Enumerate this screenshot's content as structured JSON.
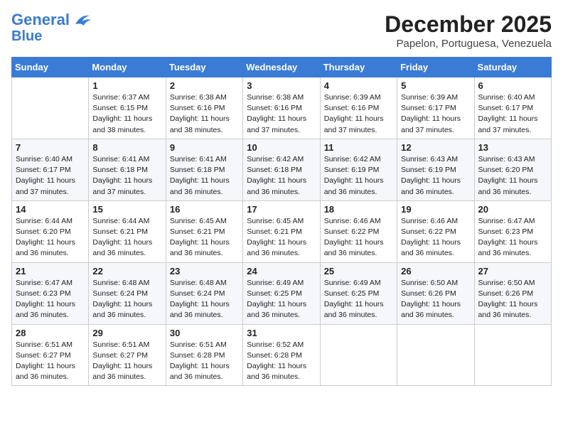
{
  "header": {
    "logo_line1": "General",
    "logo_line2": "Blue",
    "month": "December 2025",
    "location": "Papelon, Portuguesa, Venezuela"
  },
  "days_of_week": [
    "Sunday",
    "Monday",
    "Tuesday",
    "Wednesday",
    "Thursday",
    "Friday",
    "Saturday"
  ],
  "weeks": [
    [
      {
        "day": "",
        "sunrise": "",
        "sunset": "",
        "daylight": ""
      },
      {
        "day": "1",
        "sunrise": "Sunrise: 6:37 AM",
        "sunset": "Sunset: 6:15 PM",
        "daylight": "Daylight: 11 hours and 38 minutes."
      },
      {
        "day": "2",
        "sunrise": "Sunrise: 6:38 AM",
        "sunset": "Sunset: 6:16 PM",
        "daylight": "Daylight: 11 hours and 38 minutes."
      },
      {
        "day": "3",
        "sunrise": "Sunrise: 6:38 AM",
        "sunset": "Sunset: 6:16 PM",
        "daylight": "Daylight: 11 hours and 37 minutes."
      },
      {
        "day": "4",
        "sunrise": "Sunrise: 6:39 AM",
        "sunset": "Sunset: 6:16 PM",
        "daylight": "Daylight: 11 hours and 37 minutes."
      },
      {
        "day": "5",
        "sunrise": "Sunrise: 6:39 AM",
        "sunset": "Sunset: 6:17 PM",
        "daylight": "Daylight: 11 hours and 37 minutes."
      },
      {
        "day": "6",
        "sunrise": "Sunrise: 6:40 AM",
        "sunset": "Sunset: 6:17 PM",
        "daylight": "Daylight: 11 hours and 37 minutes."
      }
    ],
    [
      {
        "day": "7",
        "sunrise": "Sunrise: 6:40 AM",
        "sunset": "Sunset: 6:17 PM",
        "daylight": "Daylight: 11 hours and 37 minutes."
      },
      {
        "day": "8",
        "sunrise": "Sunrise: 6:41 AM",
        "sunset": "Sunset: 6:18 PM",
        "daylight": "Daylight: 11 hours and 37 minutes."
      },
      {
        "day": "9",
        "sunrise": "Sunrise: 6:41 AM",
        "sunset": "Sunset: 6:18 PM",
        "daylight": "Daylight: 11 hours and 36 minutes."
      },
      {
        "day": "10",
        "sunrise": "Sunrise: 6:42 AM",
        "sunset": "Sunset: 6:18 PM",
        "daylight": "Daylight: 11 hours and 36 minutes."
      },
      {
        "day": "11",
        "sunrise": "Sunrise: 6:42 AM",
        "sunset": "Sunset: 6:19 PM",
        "daylight": "Daylight: 11 hours and 36 minutes."
      },
      {
        "day": "12",
        "sunrise": "Sunrise: 6:43 AM",
        "sunset": "Sunset: 6:19 PM",
        "daylight": "Daylight: 11 hours and 36 minutes."
      },
      {
        "day": "13",
        "sunrise": "Sunrise: 6:43 AM",
        "sunset": "Sunset: 6:20 PM",
        "daylight": "Daylight: 11 hours and 36 minutes."
      }
    ],
    [
      {
        "day": "14",
        "sunrise": "Sunrise: 6:44 AM",
        "sunset": "Sunset: 6:20 PM",
        "daylight": "Daylight: 11 hours and 36 minutes."
      },
      {
        "day": "15",
        "sunrise": "Sunrise: 6:44 AM",
        "sunset": "Sunset: 6:21 PM",
        "daylight": "Daylight: 11 hours and 36 minutes."
      },
      {
        "day": "16",
        "sunrise": "Sunrise: 6:45 AM",
        "sunset": "Sunset: 6:21 PM",
        "daylight": "Daylight: 11 hours and 36 minutes."
      },
      {
        "day": "17",
        "sunrise": "Sunrise: 6:45 AM",
        "sunset": "Sunset: 6:21 PM",
        "daylight": "Daylight: 11 hours and 36 minutes."
      },
      {
        "day": "18",
        "sunrise": "Sunrise: 6:46 AM",
        "sunset": "Sunset: 6:22 PM",
        "daylight": "Daylight: 11 hours and 36 minutes."
      },
      {
        "day": "19",
        "sunrise": "Sunrise: 6:46 AM",
        "sunset": "Sunset: 6:22 PM",
        "daylight": "Daylight: 11 hours and 36 minutes."
      },
      {
        "day": "20",
        "sunrise": "Sunrise: 6:47 AM",
        "sunset": "Sunset: 6:23 PM",
        "daylight": "Daylight: 11 hours and 36 minutes."
      }
    ],
    [
      {
        "day": "21",
        "sunrise": "Sunrise: 6:47 AM",
        "sunset": "Sunset: 6:23 PM",
        "daylight": "Daylight: 11 hours and 36 minutes."
      },
      {
        "day": "22",
        "sunrise": "Sunrise: 6:48 AM",
        "sunset": "Sunset: 6:24 PM",
        "daylight": "Daylight: 11 hours and 36 minutes."
      },
      {
        "day": "23",
        "sunrise": "Sunrise: 6:48 AM",
        "sunset": "Sunset: 6:24 PM",
        "daylight": "Daylight: 11 hours and 36 minutes."
      },
      {
        "day": "24",
        "sunrise": "Sunrise: 6:49 AM",
        "sunset": "Sunset: 6:25 PM",
        "daylight": "Daylight: 11 hours and 36 minutes."
      },
      {
        "day": "25",
        "sunrise": "Sunrise: 6:49 AM",
        "sunset": "Sunset: 6:25 PM",
        "daylight": "Daylight: 11 hours and 36 minutes."
      },
      {
        "day": "26",
        "sunrise": "Sunrise: 6:50 AM",
        "sunset": "Sunset: 6:26 PM",
        "daylight": "Daylight: 11 hours and 36 minutes."
      },
      {
        "day": "27",
        "sunrise": "Sunrise: 6:50 AM",
        "sunset": "Sunset: 6:26 PM",
        "daylight": "Daylight: 11 hours and 36 minutes."
      }
    ],
    [
      {
        "day": "28",
        "sunrise": "Sunrise: 6:51 AM",
        "sunset": "Sunset: 6:27 PM",
        "daylight": "Daylight: 11 hours and 36 minutes."
      },
      {
        "day": "29",
        "sunrise": "Sunrise: 6:51 AM",
        "sunset": "Sunset: 6:27 PM",
        "daylight": "Daylight: 11 hours and 36 minutes."
      },
      {
        "day": "30",
        "sunrise": "Sunrise: 6:51 AM",
        "sunset": "Sunset: 6:28 PM",
        "daylight": "Daylight: 11 hours and 36 minutes."
      },
      {
        "day": "31",
        "sunrise": "Sunrise: 6:52 AM",
        "sunset": "Sunset: 6:28 PM",
        "daylight": "Daylight: 11 hours and 36 minutes."
      },
      {
        "day": "",
        "sunrise": "",
        "sunset": "",
        "daylight": ""
      },
      {
        "day": "",
        "sunrise": "",
        "sunset": "",
        "daylight": ""
      },
      {
        "day": "",
        "sunrise": "",
        "sunset": "",
        "daylight": ""
      }
    ]
  ]
}
